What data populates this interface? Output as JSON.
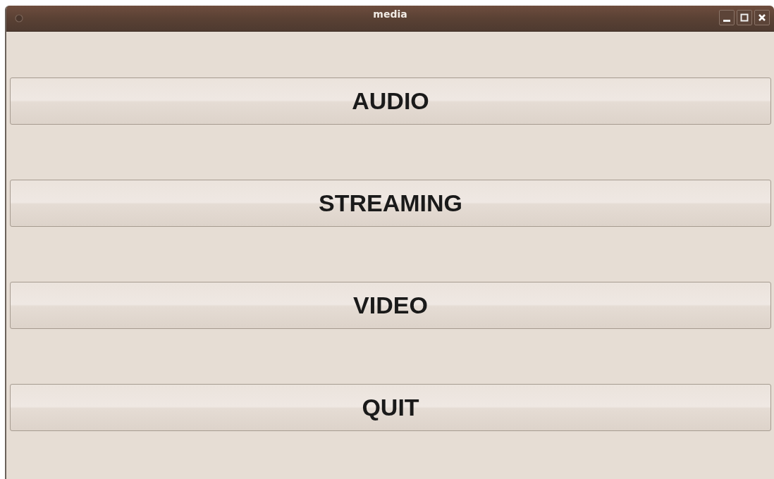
{
  "window": {
    "title": "media"
  },
  "buttons": [
    {
      "label": "AUDIO"
    },
    {
      "label": "STREAMING"
    },
    {
      "label": "VIDEO"
    },
    {
      "label": "QUIT"
    }
  ]
}
